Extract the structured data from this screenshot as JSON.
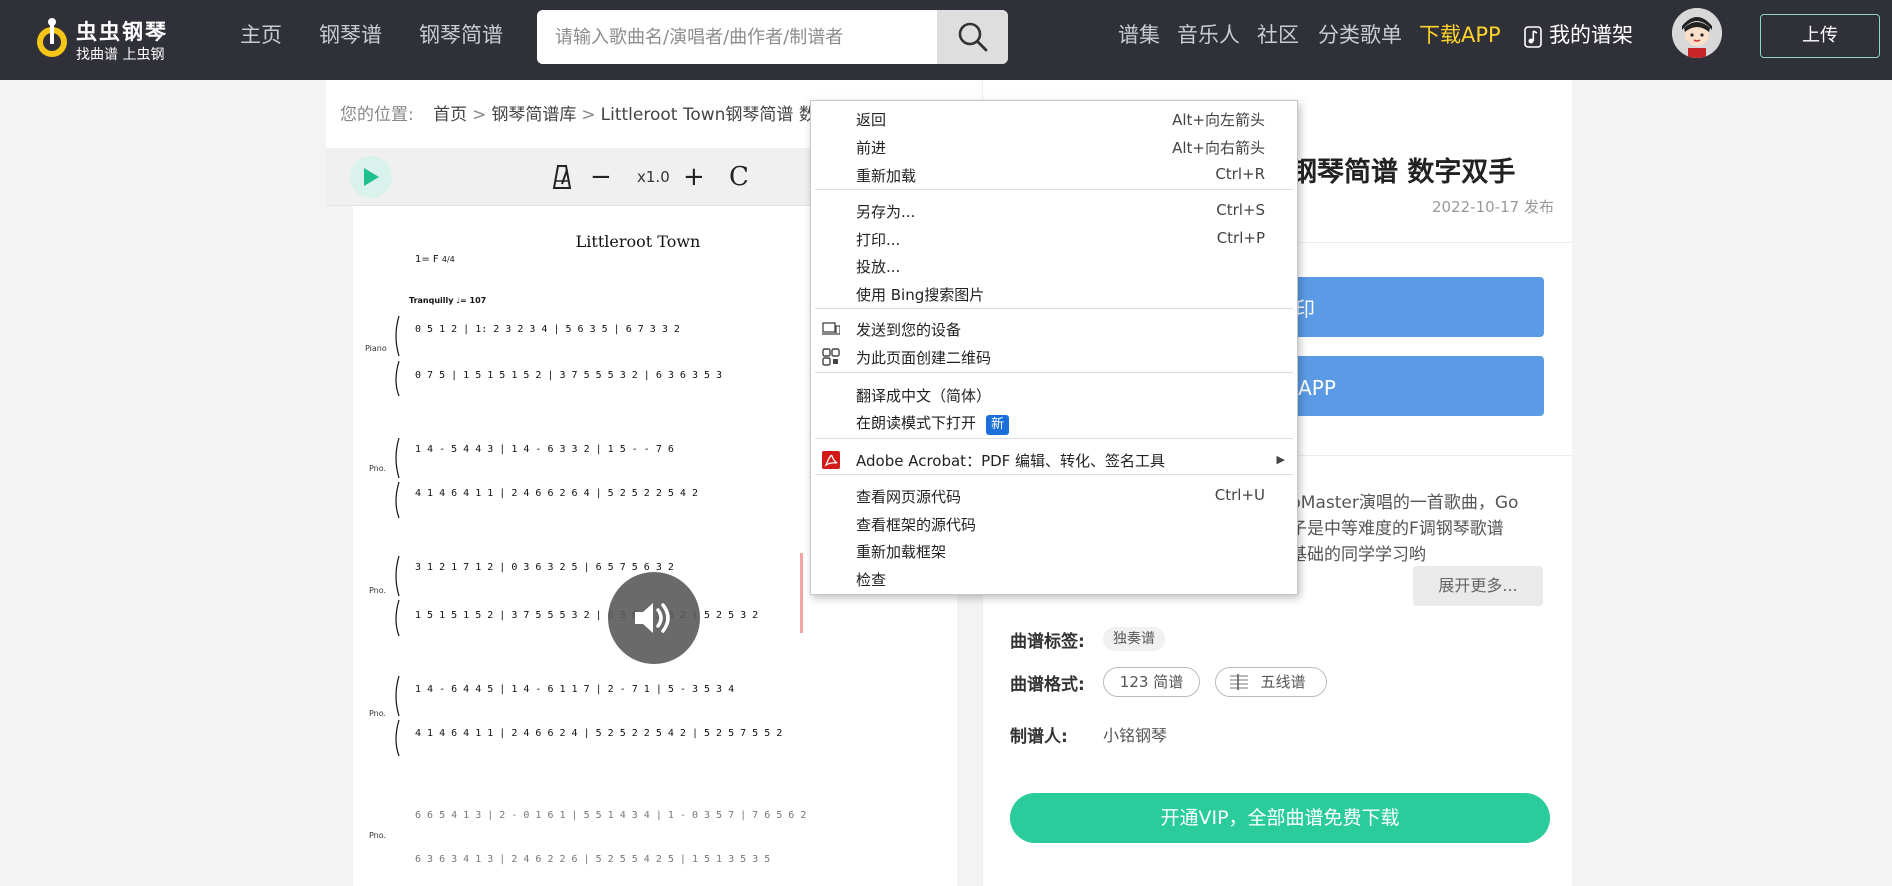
{
  "header": {
    "logo_title": "虫虫钢琴",
    "logo_subtitle": "找曲谱 上虫钢",
    "nav": [
      "主页",
      "钢琴谱",
      "钢琴简谱"
    ],
    "search_placeholder": "请输入歌曲名/演唱者/曲作者/制谱者",
    "nav_right": [
      "谱集",
      "音乐人",
      "社区",
      "分类歌单"
    ],
    "download_app": "下载APP",
    "my_sheets": "我的谱架",
    "upload": "上传",
    "colors": {
      "bg": "#2f3038",
      "highlight": "#ffd42a",
      "upload_border": "#8fd3c9"
    }
  },
  "breadcrumb": {
    "prefix": "您的位置:",
    "items": [
      "首页",
      "钢琴简谱库",
      "Littleroot Town钢琴简谱 数字"
    ]
  },
  "player": {
    "speed": "x1.0",
    "minus": "−",
    "plus": "+",
    "reset": "C"
  },
  "sheet": {
    "title": "Littleroot Town",
    "key": "1= F",
    "time_sig": "4/4",
    "tempo": "Tranquilly ♩= 107",
    "labels": [
      "Piano",
      "Pno.",
      "Pno.",
      "Pno.",
      "Pno."
    ]
  },
  "song": {
    "title": "钢琴简谱 数字双手",
    "date": "2022-10-17 发布",
    "print_btn": "打印",
    "download_btn": "下载APP",
    "desc_lines": [
      "pMaster演唱的一首歌曲，Go",
      "子是中等难度的F调钢琴歌谱",
      "基础的同学学习哟"
    ],
    "expand": "展开更多...",
    "tags_label": "曲谱标签:",
    "tag": "独奏谱",
    "format_label": "曲谱格式:",
    "format_jianpu": "123 简谱",
    "format_staff": "五线谱",
    "maker_label": "制谱人:",
    "maker": "小铭钢琴",
    "vip": "开通VIP，全部曲谱免费下载",
    "colors": {
      "primary": "#5b9ae5",
      "vip": "#29cc9a"
    }
  },
  "context_menu": {
    "items": [
      {
        "label": "返回",
        "shortcut": "Alt+向左箭头"
      },
      {
        "label": "前进",
        "shortcut": "Alt+向右箭头"
      },
      {
        "label": "重新加载",
        "shortcut": "Ctrl+R"
      },
      {
        "label": "另存为...",
        "shortcut": "Ctrl+S"
      },
      {
        "label": "打印...",
        "shortcut": "Ctrl+P"
      },
      {
        "label": "投放...",
        "shortcut": ""
      },
      {
        "label": "使用 Bing搜索图片",
        "shortcut": ""
      },
      {
        "label": "发送到您的设备",
        "shortcut": ""
      },
      {
        "label": "为此页面创建二维码",
        "shortcut": ""
      },
      {
        "label": "翻译成中文（简体）",
        "shortcut": ""
      },
      {
        "label": "在朗读模式下打开",
        "shortcut": "",
        "badge": "新"
      },
      {
        "label": "Adobe Acrobat：PDF 编辑、转化、签名工具",
        "shortcut": ""
      },
      {
        "label": "查看网页源代码",
        "shortcut": "Ctrl+U"
      },
      {
        "label": "查看框架的源代码",
        "shortcut": ""
      },
      {
        "label": "重新加载框架",
        "shortcut": ""
      },
      {
        "label": "检查",
        "shortcut": ""
      }
    ]
  }
}
